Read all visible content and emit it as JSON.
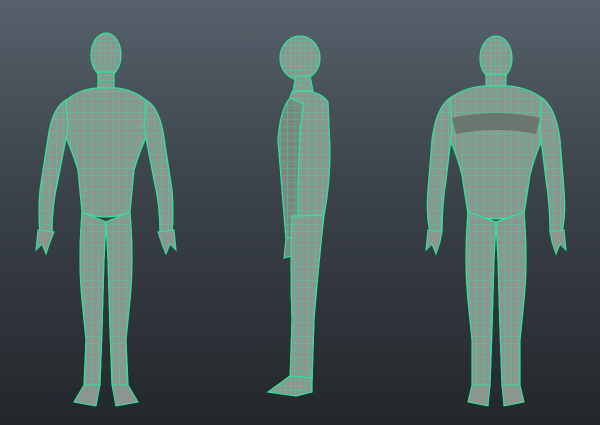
{
  "viewport": {
    "background_top": "#56616b",
    "background_bottom": "#22272b"
  },
  "mesh": {
    "wire_color": "#31e39a",
    "body_color": "#8b9690",
    "body_shade": "#6c7670",
    "views": [
      "front",
      "side",
      "back"
    ]
  }
}
